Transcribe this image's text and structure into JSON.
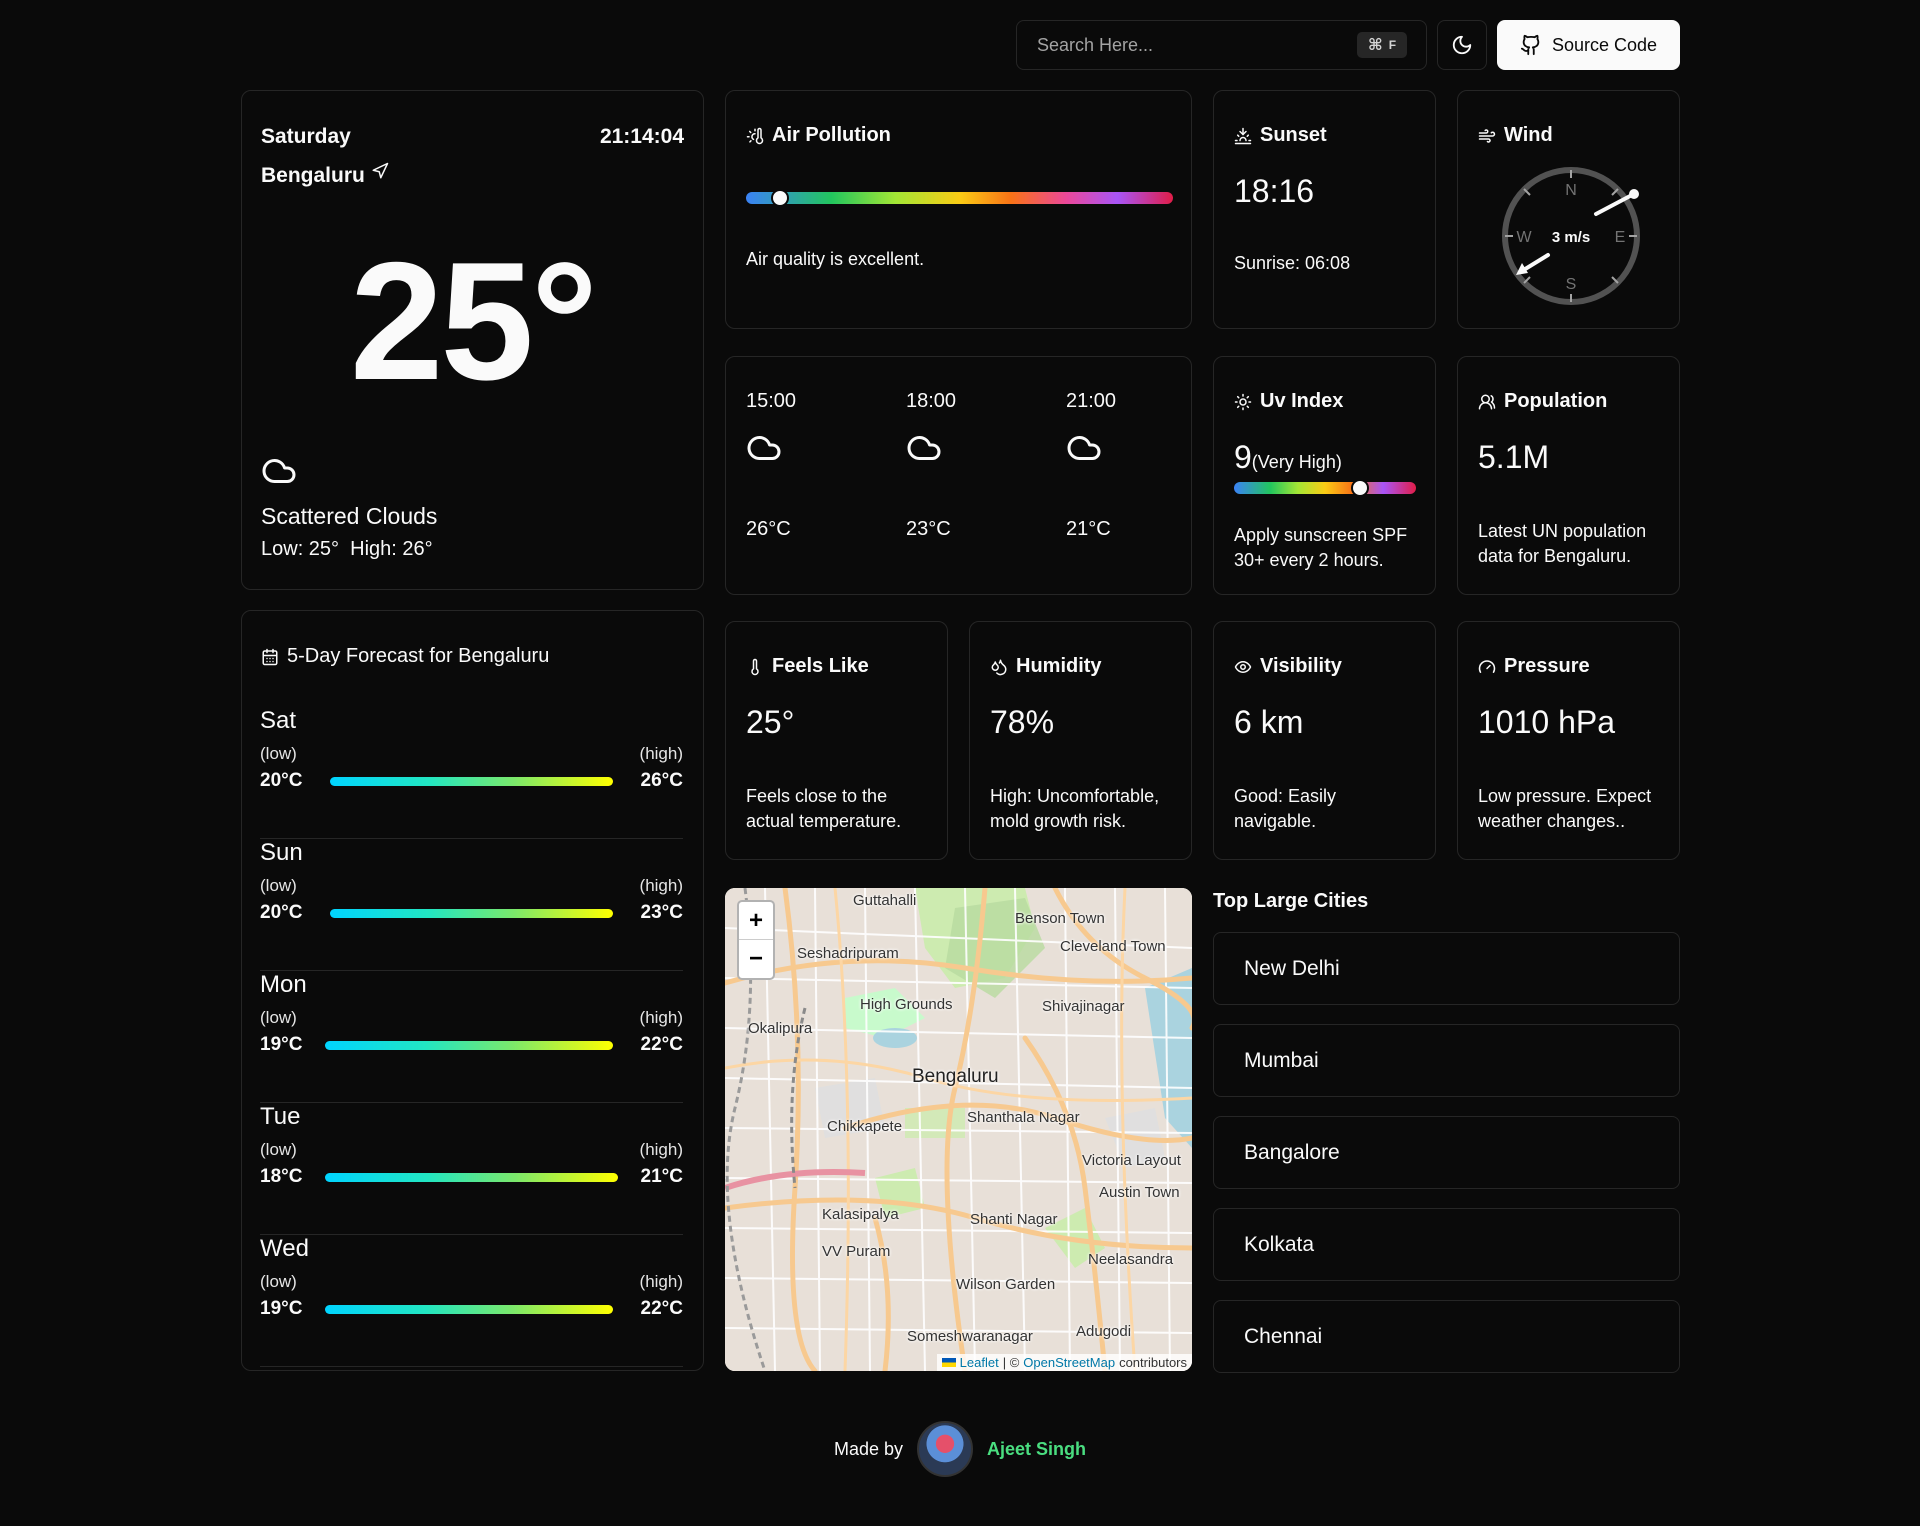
{
  "header": {
    "search_placeholder": "Search Here...",
    "search_shortcut_key": "F",
    "source_label": "Source Code"
  },
  "current": {
    "day": "Saturday",
    "time": "21:14:04",
    "city": "Bengaluru",
    "temp": "25°",
    "condition": "Scattered Clouds",
    "low_high": "Low: 25°  High: 26°"
  },
  "air": {
    "title": "Air Pollution",
    "text": "Air quality is excellent.",
    "level": 0.08
  },
  "sunset": {
    "title": "Sunset",
    "time": "18:16",
    "sunrise": "Sunrise: 06:08"
  },
  "wind": {
    "title": "Wind",
    "speed": "3 m/s",
    "n": "N",
    "e": "E",
    "s": "S",
    "w": "W"
  },
  "hourly": [
    {
      "time": "15:00",
      "temp": "26°C",
      "icon": "cloud-icon"
    },
    {
      "time": "18:00",
      "temp": "23°C",
      "icon": "cloud-icon"
    },
    {
      "time": "21:00",
      "temp": "21°C",
      "icon": "cloud-icon"
    }
  ],
  "uv": {
    "title": "Uv Index",
    "value": "9",
    "label": "(Very High)",
    "level": 0.69,
    "text1": "Apply sunscreen SPF",
    "text2": "30+ every 2 hours."
  },
  "population": {
    "title": "Population",
    "value": "5.1M",
    "text1": "Latest UN population",
    "text2": "data for Bengaluru."
  },
  "forecast": {
    "title": "5-Day Forecast for Bengaluru",
    "low_label": "(low)",
    "high_label": "(high)",
    "days": [
      {
        "day": "Sat",
        "low": "20°C",
        "high": "26°C"
      },
      {
        "day": "Sun",
        "low": "20°C",
        "high": "23°C"
      },
      {
        "day": "Mon",
        "low": "19°C",
        "high": "22°C"
      },
      {
        "day": "Tue",
        "low": "18°C",
        "high": "21°C"
      },
      {
        "day": "Wed",
        "low": "19°C",
        "high": "22°C"
      }
    ]
  },
  "feels": {
    "title": "Feels Like",
    "value": "25°",
    "text1": "Feels close to the",
    "text2": "actual temperature."
  },
  "humidity": {
    "title": "Humidity",
    "value": "78%",
    "text1": "High: Uncomfortable,",
    "text2": "mold growth risk."
  },
  "visibility": {
    "title": "Visibility",
    "value": "6 km",
    "text1": "Good: Easily",
    "text2": "navigable."
  },
  "pressure": {
    "title": "Pressure",
    "value": "1010 hPa",
    "text1": "Low pressure. Expect",
    "text2": "weather changes.."
  },
  "map": {
    "zoom_in": "+",
    "zoom_out": "−",
    "attribution_leaflet": "Leaflet",
    "attribution_sep": "| ©",
    "attribution_osm": "OpenStreetMap",
    "attribution_tail": "contributors",
    "labels": {
      "guttahalli": "Guttahalli",
      "benson": "Benson Town",
      "cleveland": "Cleveland Town",
      "seshadri": "Seshadripuram",
      "highgrounds": "High Grounds",
      "shivaji": "Shivajinagar",
      "okalipura": "Okalipura",
      "bengaluru": "Bengaluru",
      "chikkapete": "Chikkapete",
      "shanthala": "Shanthala Nagar",
      "victoria": "Victoria Layout",
      "austin": "Austin Town",
      "kalasipalya": "Kalasipalya",
      "shanti": "Shanti Nagar",
      "vvpuram": "VV Puram",
      "neelasandra": "Neelasandra",
      "wilson": "Wilson Garden",
      "someshwara": "Someshwaranagar",
      "adugodi": "Adugodi"
    }
  },
  "cities": {
    "title": "Top Large Cities",
    "list": [
      "New Delhi",
      "Mumbai",
      "Bangalore",
      "Kolkata",
      "Chennai"
    ]
  },
  "footer": {
    "made_by": "Made by",
    "author": "Ajeet Singh"
  }
}
